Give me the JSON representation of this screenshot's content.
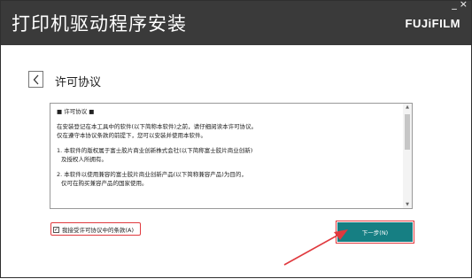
{
  "window": {
    "title": "打印机驱动程序安装",
    "brand": "FUJiFILM",
    "minimize": "_",
    "close": "×"
  },
  "page": {
    "back_icon": "chevron-left-icon",
    "title": "许可协议"
  },
  "license": {
    "heading": "■ 许可协议 ■",
    "para1": [
      "在安装登记在本工具中的软件(以下简称本软件)之前，请仔细阅读本许可协议。",
      "仅在遵守本协议条款的前提下，您可以安装并使用本软件。"
    ],
    "item1": [
      "1. 本软件的版权属于富士胶片商业创新株式会社(以下简称富士胶片商业创新)",
      "及授权人所拥有。"
    ],
    "item2": [
      "2. 本软件以使用兼容的富士胶片商业创新产品(以下简称兼容产品)为目的，",
      "仅可在购买兼容产品的国家使用。"
    ]
  },
  "agree": {
    "checked": true,
    "check_mark": "✓",
    "label": "我接受许可协议中的条款(A)"
  },
  "next_button": {
    "label": "下一步(N)"
  },
  "colors": {
    "header": "#3a3a3a",
    "button": "#167f83",
    "highlight": "#e0393e"
  }
}
